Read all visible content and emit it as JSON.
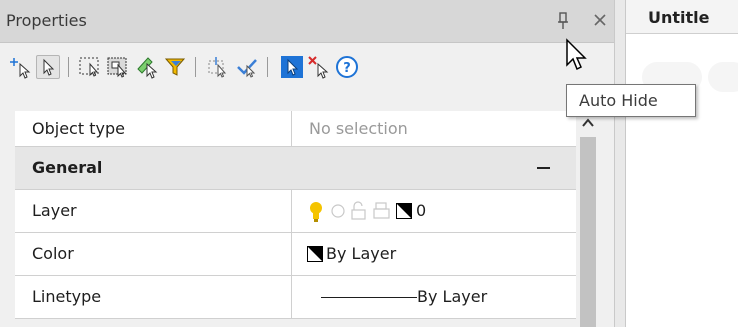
{
  "palette": {
    "title": "Properties",
    "header_icons": [
      "pin-icon",
      "close-icon"
    ]
  },
  "toolbar": {
    "icons": [
      "add-selection-icon",
      "select-objects-icon",
      "window-select-icon",
      "crossing-select-icon",
      "quick-select-icon",
      "filter-icon",
      "select-similar-icon",
      "match-properties-icon",
      "toggle-pickadd-icon",
      "deselect-icon",
      "help-icon"
    ]
  },
  "grid": {
    "rows": [
      {
        "label": "Object type",
        "value": "No selection"
      },
      {
        "category": "General"
      },
      {
        "label": "Layer",
        "value": "0"
      },
      {
        "label": "Color",
        "value": "By Layer"
      },
      {
        "label": "Linetype",
        "value": "By Layer"
      }
    ]
  },
  "drawing": {
    "tab_title": "Untitle"
  },
  "tooltip": {
    "text": "Auto Hide"
  },
  "colors": {
    "header_bg": "#d7d7d7",
    "panel_bg": "#f0f0f0",
    "category_bg": "#e6e6e6",
    "accent_blue": "#1e73d6",
    "bulb_yellow": "#f5c400",
    "deselect_red": "#d62b2b"
  }
}
